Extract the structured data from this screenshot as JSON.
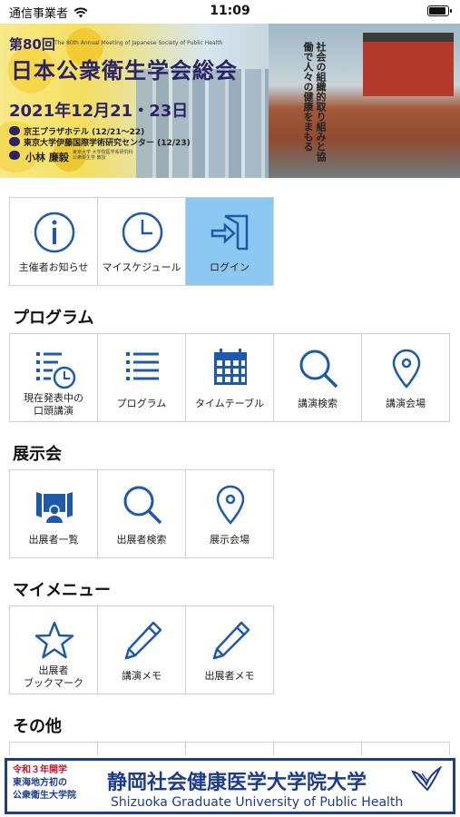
{
  "status_bar": {
    "carrier": "通信事業者",
    "time": "11:09",
    "battery_level": 0.9
  },
  "banner": {
    "ordinal": "第80回",
    "subtitle_en": "The 80th Annual Meeting of Japanese Society of Public Health",
    "title": "日本公衆衛生学会総会",
    "date": "2021年12月21・23日",
    "venue1": "京王プラザホテル (12/21〜22)",
    "venue2": "東京大学伊藤国際学術研究センター (12/23)",
    "chair": "小林 廉毅",
    "chair_affiliation": "東京大学 大学院医学系研究科 公衆衛生学 教授",
    "slogan": "社会の組織的取り組みと協働で人々の健康をまもる"
  },
  "top_menu": [
    {
      "label": "主催者お知らせ",
      "icon": "info-icon"
    },
    {
      "label": "マイスケジュール",
      "icon": "clock-icon"
    },
    {
      "label": "ログイン",
      "icon": "login-icon",
      "active": true
    }
  ],
  "sections": {
    "program": {
      "title": "プログラム",
      "items": [
        {
          "label": "現在発表中の\n口頭講演",
          "icon": "schedule-list-icon"
        },
        {
          "label": "プログラム",
          "icon": "list-icon"
        },
        {
          "label": "タイムテーブル",
          "icon": "calendar-icon"
        },
        {
          "label": "講演検索",
          "icon": "search-icon"
        },
        {
          "label": "講演会場",
          "icon": "map-pin-icon"
        }
      ]
    },
    "exhibition": {
      "title": "展示会",
      "items": [
        {
          "label": "出展者一覧",
          "icon": "exhibitor-icon"
        },
        {
          "label": "出展者検索",
          "icon": "search-icon"
        },
        {
          "label": "展示会場",
          "icon": "map-pin-icon"
        }
      ]
    },
    "my_menu": {
      "title": "マイメニュー",
      "items": [
        {
          "label": "出展者\nブックマーク",
          "icon": "star-icon"
        },
        {
          "label": "講演メモ",
          "icon": "pencil-icon"
        },
        {
          "label": "出展者メモ",
          "icon": "pencil-icon"
        }
      ]
    },
    "other": {
      "title": "その他"
    }
  },
  "ad": {
    "line1": "令和３年開学",
    "line2": "東海地方初の",
    "line3": "公衆衛生大学院",
    "name_jp": "静岡社会健康医学大学院大学",
    "name_en": "Shizuoka Graduate University of Public Health"
  },
  "colors": {
    "accent": "#1e5aa8",
    "active_tile": "#8cc8f2",
    "ad_blue": "#1e3c8c"
  }
}
